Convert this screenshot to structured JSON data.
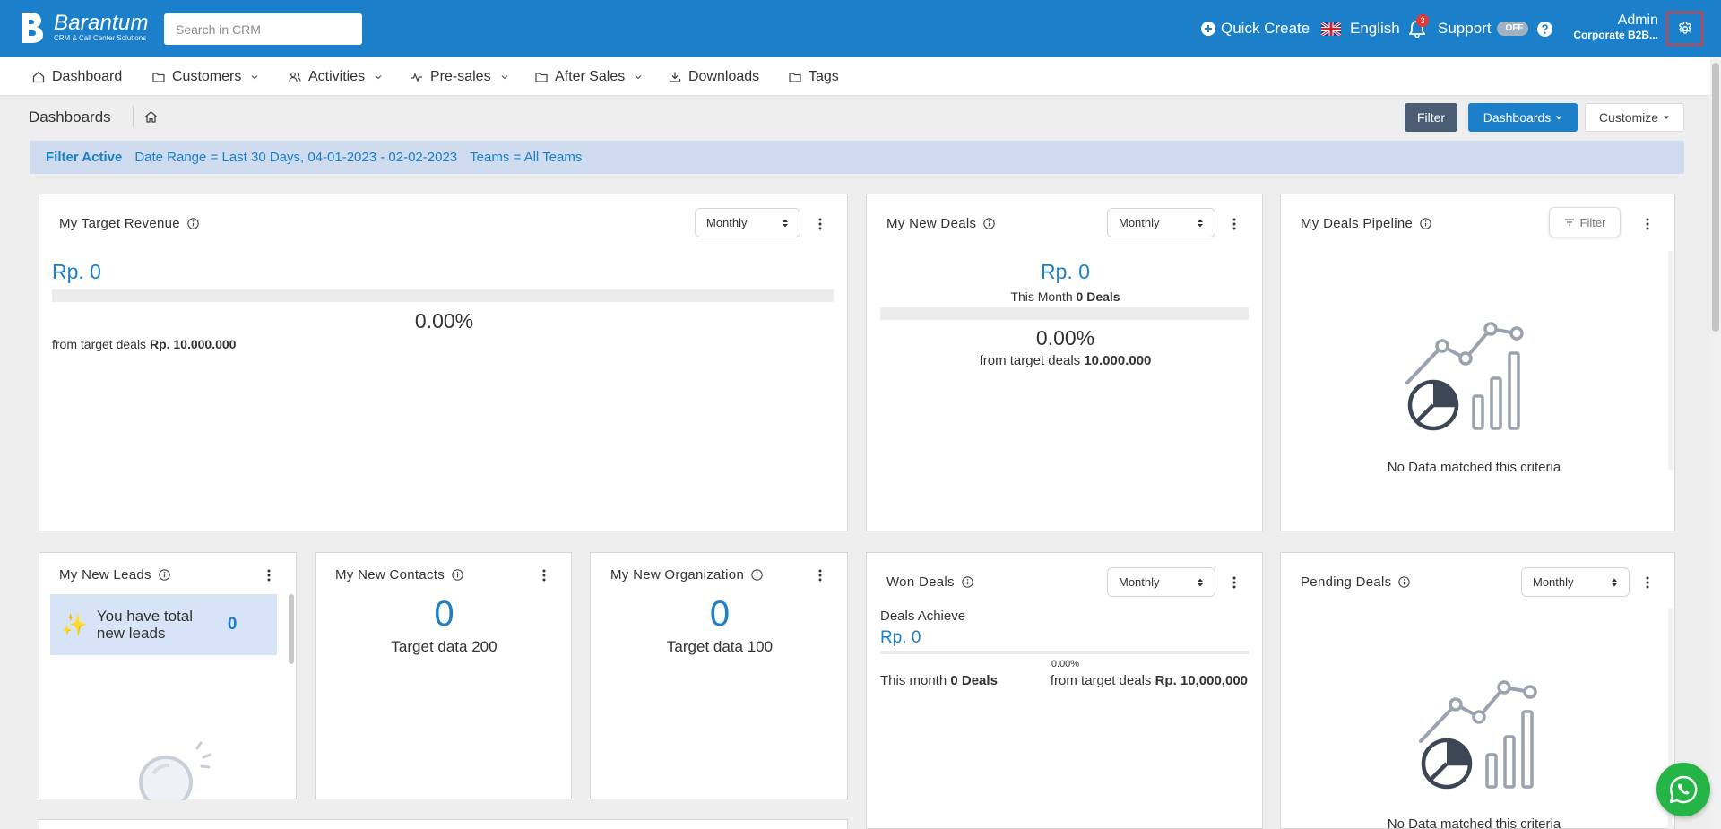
{
  "app": {
    "brand": "Barantum",
    "brand_tagline": "CRM & Call Center Solutions"
  },
  "topbar": {
    "search_placeholder": "Search in CRM",
    "quick_create": "Quick Create",
    "language": "English",
    "notification_count": "3",
    "support": "Support",
    "support_toggle": "OFF",
    "user_name": "Admin",
    "user_org": "Corporate B2B..."
  },
  "nav": {
    "items": [
      {
        "label": "Dashboard",
        "has_menu": false
      },
      {
        "label": "Customers",
        "has_menu": true
      },
      {
        "label": "Activities",
        "has_menu": true
      },
      {
        "label": "Pre-sales",
        "has_menu": true
      },
      {
        "label": "After Sales",
        "has_menu": true
      },
      {
        "label": "Downloads",
        "has_menu": false
      },
      {
        "label": "Tags",
        "has_menu": false
      }
    ]
  },
  "breadcrumb": {
    "title": "Dashboards"
  },
  "toolbar": {
    "filter": "Filter",
    "dashboards": "Dashboards",
    "customize": "Customize"
  },
  "filter_bar": {
    "label": "Filter Active",
    "date_range": "Date Range = Last 30 Days, 04-01-2023 - 02-02-2023",
    "teams": "Teams = All Teams"
  },
  "cards": {
    "target_revenue": {
      "title": "My Target Revenue",
      "period": "Monthly",
      "value": "Rp. 0",
      "percent": "0.00%",
      "progress": 0,
      "from_label": "from target deals",
      "target": "Rp. 10.000.000"
    },
    "new_deals": {
      "title": "My New Deals",
      "period": "Monthly",
      "value": "Rp. 0",
      "month_label": "This Month",
      "month_deals": "0 Deals",
      "percent": "0.00%",
      "progress": 0,
      "from_label": "from target deals",
      "target": "10.000.000"
    },
    "deals_pipeline": {
      "title": "My Deals Pipeline",
      "filter": "Filter",
      "empty": "No Data matched this criteria"
    },
    "new_leads": {
      "title": "My New Leads",
      "message": "You have total new leads",
      "count": "0",
      "emoji": "✨"
    },
    "new_contacts": {
      "title": "My New Contacts",
      "value": "0",
      "target": "Target data 200"
    },
    "new_organization": {
      "title": "My New Organization",
      "value": "0",
      "target": "Target data 100"
    },
    "won_deals": {
      "title": "Won Deals",
      "period": "Monthly",
      "achieve_label": "Deals Achieve",
      "value": "Rp. 0",
      "percent": "0.00%",
      "progress": 0,
      "month_label": "This month",
      "month_deals": "0 Deals",
      "from_label": "from target deals",
      "target": "Rp. 10,000,000"
    },
    "pending_deals": {
      "title": "Pending Deals",
      "period": "Monthly",
      "empty": "No Data matched this criteria"
    }
  },
  "colors": {
    "primary": "#1b7fc9",
    "topbar": "#1b7fc9",
    "filter_button": "#4a5d73",
    "filter_bar": "#cfdcef",
    "highlight": "#e53935",
    "whatsapp": "#25b446"
  },
  "icons": {
    "settings": "gear-icon",
    "chat": "whatsapp-icon"
  }
}
